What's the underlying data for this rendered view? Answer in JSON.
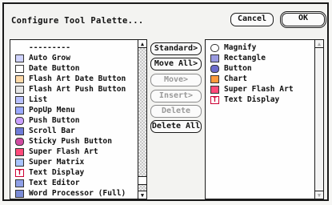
{
  "dialog": {
    "title": "Configure Tool Palette...",
    "cancel_label": "Cancel",
    "ok_label": "OK"
  },
  "available_tools": [
    {
      "label": "---------",
      "icon": "separator-icon"
    },
    {
      "label": "Auto Grow",
      "icon": "auto-grow-icon"
    },
    {
      "label": "Date Button",
      "icon": "date-button-icon"
    },
    {
      "label": "Flash Art Date Button",
      "icon": "flash-art-date-icon"
    },
    {
      "label": "Flash Art Push Button",
      "icon": "flash-art-push-icon"
    },
    {
      "label": "List",
      "icon": "list-icon"
    },
    {
      "label": "PopUp Menu",
      "icon": "popup-menu-icon"
    },
    {
      "label": "Push Button",
      "icon": "push-button-icon"
    },
    {
      "label": "Scroll Bar",
      "icon": "scroll-bar-icon"
    },
    {
      "label": "Sticky Push Button",
      "icon": "sticky-push-icon"
    },
    {
      "label": "Super Flash Art",
      "icon": "super-flash-art-icon"
    },
    {
      "label": "Super Matrix",
      "icon": "super-matrix-icon"
    },
    {
      "label": "Text Display",
      "icon": "text-display-icon"
    },
    {
      "label": "Text Editor",
      "icon": "text-editor-icon"
    },
    {
      "label": "Word Processor (Full)",
      "icon": "word-processor-icon"
    }
  ],
  "actions": {
    "standard": "Standard>",
    "move_all": "Move All>",
    "move": "Move>",
    "insert": "Insert>",
    "delete": "Delete",
    "delete_all": "Delete All"
  },
  "palette_tools": [
    {
      "label": "Magnify",
      "icon": "magnify-icon"
    },
    {
      "label": "Rectangle",
      "icon": "rectangle-icon"
    },
    {
      "label": "Button",
      "icon": "button-icon"
    },
    {
      "label": "Chart",
      "icon": "chart-icon"
    },
    {
      "label": "Super Flash Art",
      "icon": "super-flash-art-icon"
    },
    {
      "label": "Text Display",
      "icon": "text-display-icon"
    }
  ]
}
